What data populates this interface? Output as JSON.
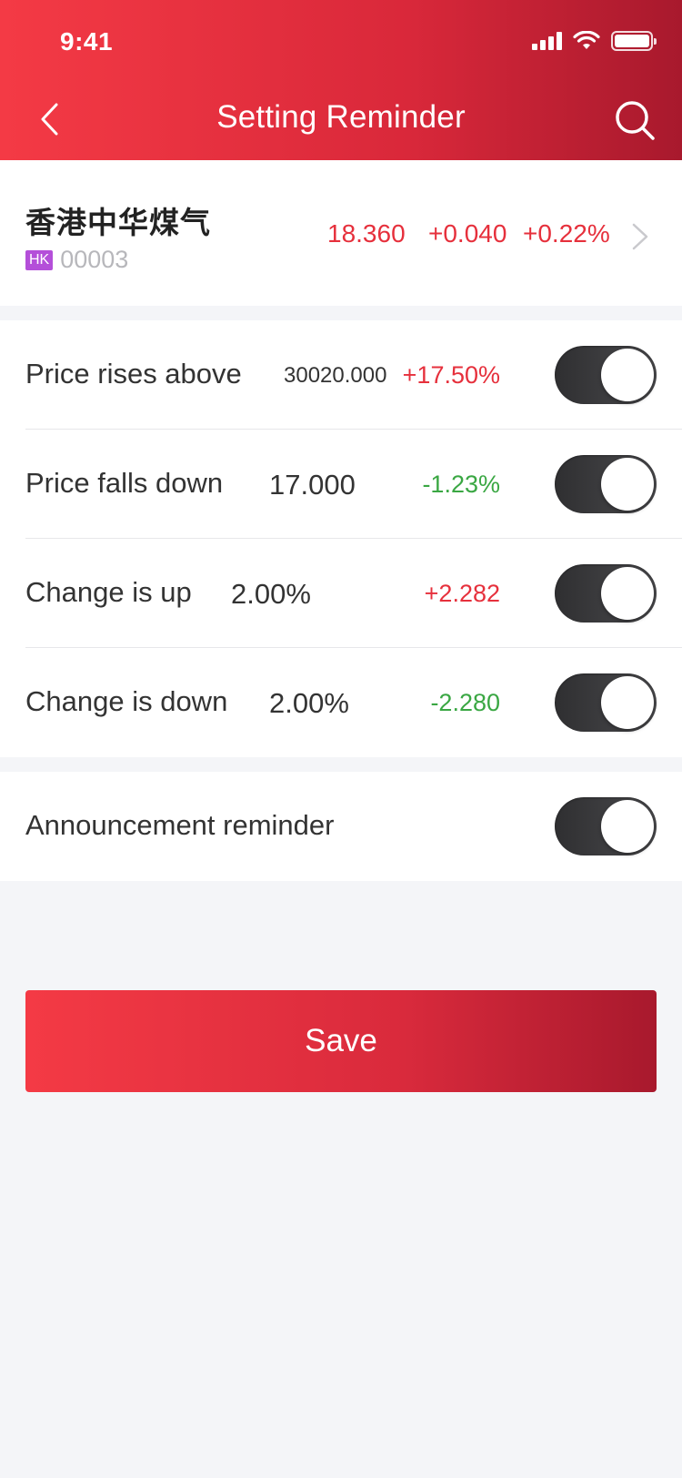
{
  "status_bar": {
    "time": "9:41"
  },
  "nav": {
    "title": "Setting Reminder"
  },
  "stock": {
    "name": "香港中华煤气",
    "market": "HK",
    "code": "00003",
    "price": "18.360",
    "change": "+0.040",
    "change_pct": "+0.22%"
  },
  "reminders": [
    {
      "label": "Price rises above",
      "value": "30020.000",
      "change": "+17.50%",
      "color": "red",
      "enabled": true
    },
    {
      "label": "Price falls down",
      "value": "17.000",
      "change": "-1.23%",
      "color": "green",
      "enabled": true
    },
    {
      "label": "Change is up",
      "value": "2.00%",
      "change": "+2.282",
      "color": "red",
      "enabled": true
    },
    {
      "label": "Change is down",
      "value": "2.00%",
      "change": "-2.280",
      "color": "green",
      "enabled": true
    }
  ],
  "announcement": {
    "label": "Announcement reminder",
    "enabled": true
  },
  "save_label": "Save",
  "colors": {
    "accent": "#e6303c",
    "up": "#e6303c",
    "down": "#3aa743",
    "market_badge": "#b44fd9"
  },
  "icons": [
    "back-icon",
    "search-icon",
    "chevron-right-icon",
    "signal-icon",
    "wifi-icon",
    "battery-icon"
  ]
}
